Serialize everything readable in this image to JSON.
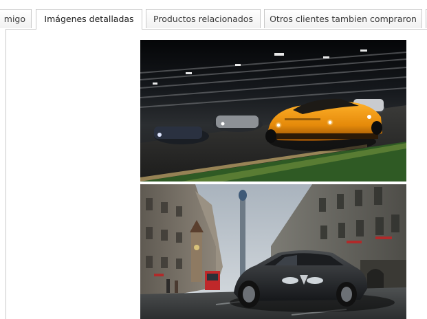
{
  "tabs": [
    {
      "label": "migo",
      "active": false
    },
    {
      "label": "Imágenes detalladas",
      "active": true
    },
    {
      "label": "Productos relacionados",
      "active": false
    },
    {
      "label": "Otros clientes tambien compraron",
      "active": false
    }
  ],
  "images": [
    {
      "subject": "orange race car on night track",
      "icon": "race-car-image"
    },
    {
      "subject": "dark sedan on old town street with clock tower",
      "icon": "street-car-image"
    }
  ]
}
